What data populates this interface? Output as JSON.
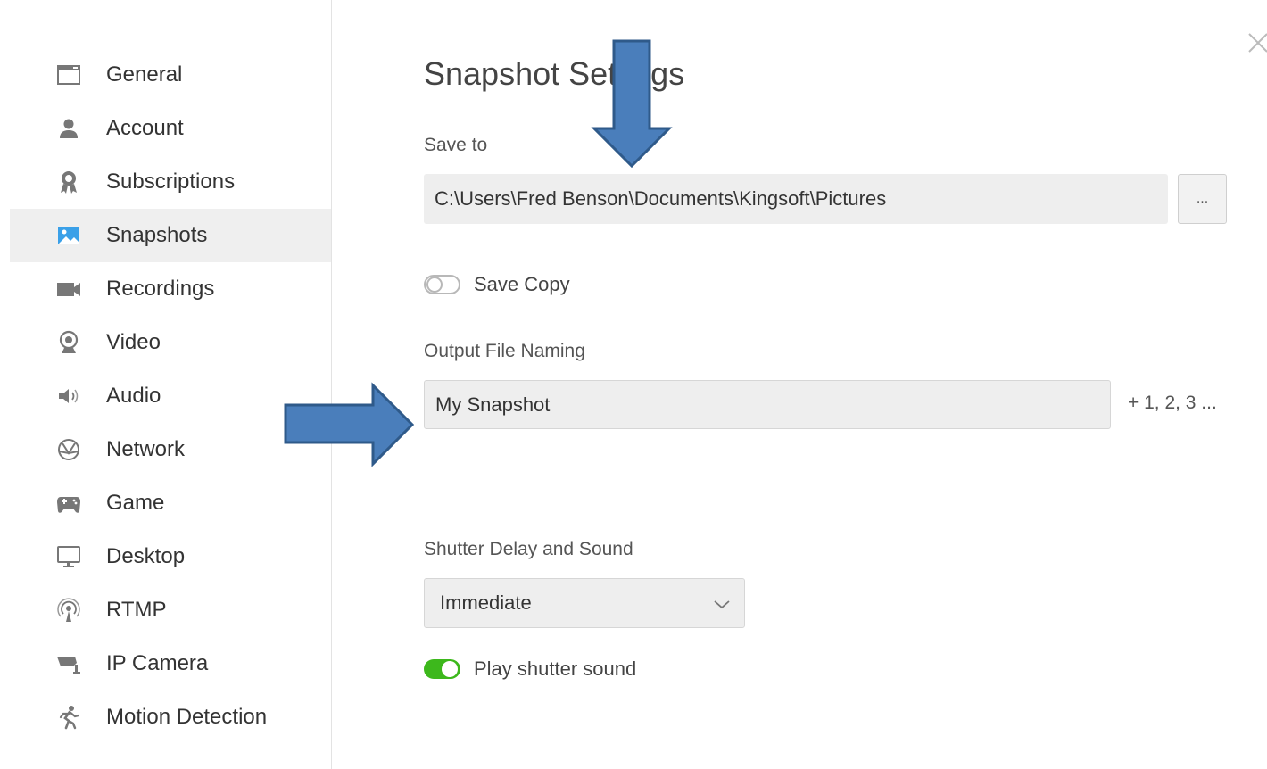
{
  "sidebar": {
    "items": [
      {
        "label": "General",
        "icon": "window-icon"
      },
      {
        "label": "Account",
        "icon": "user-icon"
      },
      {
        "label": "Subscriptions",
        "icon": "award-icon"
      },
      {
        "label": "Snapshots",
        "icon": "image-icon",
        "active": true
      },
      {
        "label": "Recordings",
        "icon": "video-camera-icon"
      },
      {
        "label": "Video",
        "icon": "webcam-icon"
      },
      {
        "label": "Audio",
        "icon": "speaker-icon"
      },
      {
        "label": "Network",
        "icon": "network-icon"
      },
      {
        "label": "Game",
        "icon": "gamepad-icon"
      },
      {
        "label": "Desktop",
        "icon": "monitor-icon"
      },
      {
        "label": "RTMP",
        "icon": "broadcast-icon"
      },
      {
        "label": "IP Camera",
        "icon": "security-camera-icon"
      },
      {
        "label": "Motion Detection",
        "icon": "running-man-icon"
      }
    ]
  },
  "main": {
    "title": "Snapshot Settings",
    "save_to": {
      "label": "Save to",
      "value": "C:\\Users\\Fred Benson\\Documents\\Kingsoft\\Pictures",
      "browse_label": "..."
    },
    "save_copy": {
      "label": "Save Copy",
      "enabled": false
    },
    "output_naming": {
      "label": "Output File Naming",
      "value": "My Snapshot",
      "suffix": "+ 1, 2, 3 ..."
    },
    "shutter": {
      "label": "Shutter Delay and Sound",
      "selected": "Immediate",
      "play_sound_label": "Play shutter sound",
      "play_sound_enabled": true
    }
  },
  "colors": {
    "accent_green": "#3db81c",
    "active_icon_blue": "#3aa0e8",
    "arrow_fill": "#4a7ebb",
    "arrow_stroke": "#2f5a8a"
  }
}
